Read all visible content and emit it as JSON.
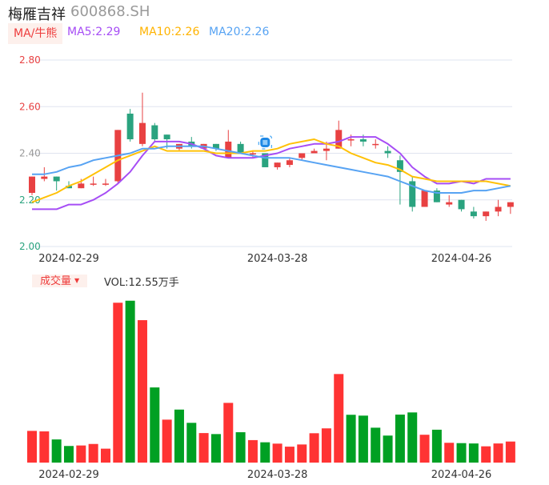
{
  "header": {
    "name": "梅雁吉祥",
    "code": "600868.SH"
  },
  "ma_legend": {
    "tag": "MA/牛熊",
    "ma5": "MA5:2.29",
    "ma10": "MA10:2.26",
    "ma20": "MA20:2.26"
  },
  "volume_legend": {
    "tag": "成交量",
    "value": "VOL:12.55万手"
  },
  "colors": {
    "up": "#e84142",
    "down": "#2aa37f",
    "vol_up": "#ff3333",
    "vol_down": "#00a023",
    "ma5": "#a64df5",
    "ma10": "#ffc107",
    "ma20": "#57a3f3",
    "grid": "#dfe4f0"
  },
  "chart_data": [
    {
      "type": "candlestick",
      "title": "梅雁吉祥 600868.SH",
      "ylim": [
        2.0,
        2.8
      ],
      "y_ticks": [
        "2.80",
        "2.60",
        "2.40",
        "2.20",
        "2.00"
      ],
      "y_tick_values": [
        2.8,
        2.6,
        2.4,
        2.2,
        2.0
      ],
      "y_tick_colors": [
        "#e84142",
        "#e84142",
        "#999999",
        "#2aa37f",
        "#2aa37f"
      ],
      "x_tick_labels": [
        {
          "index": 3,
          "label": "2024-02-29"
        },
        {
          "index": 20,
          "label": "2024-03-28"
        },
        {
          "index": 35,
          "label": "2024-04-26"
        }
      ],
      "ohlc": [
        [
          2.23,
          2.3,
          2.22,
          2.3
        ],
        [
          2.29,
          2.34,
          2.28,
          2.3
        ],
        [
          2.3,
          2.3,
          2.24,
          2.28
        ],
        [
          2.26,
          2.28,
          2.25,
          2.25
        ],
        [
          2.25,
          2.29,
          2.25,
          2.27
        ],
        [
          2.27,
          2.3,
          2.26,
          2.27
        ],
        [
          2.27,
          2.29,
          2.26,
          2.27
        ],
        [
          2.28,
          2.5,
          2.27,
          2.5
        ],
        [
          2.57,
          2.59,
          2.45,
          2.46
        ],
        [
          2.44,
          2.66,
          2.43,
          2.53
        ],
        [
          2.52,
          2.53,
          2.45,
          2.46
        ],
        [
          2.48,
          2.48,
          2.42,
          2.46
        ],
        [
          2.42,
          2.44,
          2.41,
          2.44
        ],
        [
          2.45,
          2.47,
          2.42,
          2.43
        ],
        [
          2.42,
          2.44,
          2.42,
          2.44
        ],
        [
          2.44,
          2.44,
          2.41,
          2.42
        ],
        [
          2.38,
          2.5,
          2.38,
          2.45
        ],
        [
          2.44,
          2.45,
          2.4,
          2.4
        ],
        [
          2.4,
          2.41,
          2.38,
          2.4
        ],
        [
          2.4,
          2.4,
          2.34,
          2.34
        ],
        [
          2.34,
          2.36,
          2.33,
          2.36
        ],
        [
          2.35,
          2.38,
          2.34,
          2.37
        ],
        [
          2.38,
          2.4,
          2.37,
          2.4
        ],
        [
          2.4,
          2.42,
          2.4,
          2.41
        ],
        [
          2.41,
          2.45,
          2.37,
          2.42
        ],
        [
          2.42,
          2.54,
          2.42,
          2.5
        ],
        [
          2.46,
          2.48,
          2.43,
          2.46
        ],
        [
          2.46,
          2.48,
          2.43,
          2.45
        ],
        [
          2.44,
          2.46,
          2.42,
          2.44
        ],
        [
          2.41,
          2.43,
          2.38,
          2.4
        ],
        [
          2.37,
          2.39,
          2.18,
          2.32
        ],
        [
          2.28,
          2.3,
          2.15,
          2.17
        ],
        [
          2.17,
          2.24,
          2.17,
          2.24
        ],
        [
          2.24,
          2.25,
          2.19,
          2.19
        ],
        [
          2.18,
          2.22,
          2.17,
          2.19
        ],
        [
          2.2,
          2.2,
          2.15,
          2.16
        ],
        [
          2.15,
          2.17,
          2.12,
          2.13
        ],
        [
          2.13,
          2.15,
          2.11,
          2.15
        ],
        [
          2.15,
          2.2,
          2.13,
          2.17
        ],
        [
          2.17,
          2.19,
          2.14,
          2.19
        ]
      ],
      "series": [
        {
          "name": "MA5",
          "values": [
            2.16,
            2.16,
            2.16,
            2.18,
            2.18,
            2.2,
            2.23,
            2.27,
            2.32,
            2.39,
            2.45,
            2.45,
            2.45,
            2.44,
            2.42,
            2.39,
            2.38,
            2.38,
            2.38,
            2.39,
            2.4,
            2.42,
            2.43,
            2.44,
            2.44,
            2.45,
            2.47,
            2.47,
            2.47,
            2.44,
            2.4,
            2.34,
            2.3,
            2.27,
            2.27,
            2.28,
            2.27,
            2.29,
            2.29,
            2.29
          ]
        },
        {
          "name": "MA10",
          "values": [
            2.19,
            2.21,
            2.23,
            2.26,
            2.28,
            2.31,
            2.34,
            2.37,
            2.39,
            2.41,
            2.43,
            2.41,
            2.41,
            2.41,
            2.41,
            2.4,
            2.4,
            2.4,
            2.41,
            2.41,
            2.42,
            2.44,
            2.45,
            2.46,
            2.44,
            2.43,
            2.4,
            2.38,
            2.36,
            2.35,
            2.33,
            2.3,
            2.29,
            2.28,
            2.28,
            2.28,
            2.28,
            2.28,
            2.27,
            2.26
          ]
        },
        {
          "name": "MA20",
          "values": [
            2.31,
            2.31,
            2.32,
            2.34,
            2.35,
            2.37,
            2.38,
            2.39,
            2.4,
            2.42,
            2.42,
            2.43,
            2.43,
            2.43,
            2.43,
            2.42,
            2.41,
            2.4,
            2.39,
            2.38,
            2.38,
            2.38,
            2.37,
            2.36,
            2.35,
            2.34,
            2.33,
            2.32,
            2.31,
            2.3,
            2.28,
            2.26,
            2.24,
            2.23,
            2.23,
            2.23,
            2.24,
            2.24,
            2.25,
            2.26
          ]
        }
      ],
      "marker": {
        "index": 19,
        "icon": "bull-bear-icon"
      }
    },
    {
      "type": "bar",
      "title": "成交量",
      "unit": "万手",
      "ylim": [
        0,
        100
      ],
      "x_tick_labels": [
        {
          "index": 3,
          "label": "2024-02-29"
        },
        {
          "index": 20,
          "label": "2024-03-28"
        },
        {
          "index": 35,
          "label": "2024-04-26"
        }
      ],
      "values": [
        18.9,
        18.6,
        13.8,
        9.9,
        10.2,
        11.1,
        8.3,
        95.3,
        96.5,
        84.9,
        44.8,
        25.6,
        31.6,
        23.7,
        17.6,
        17.0,
        35.6,
        18.1,
        13.4,
        12.1,
        11.3,
        9.5,
        10.8,
        17.5,
        20.4,
        52.8,
        28.5,
        28.0,
        20.8,
        16.1,
        28.6,
        29.9,
        16.6,
        19.6,
        11.8,
        11.6,
        11.4,
        9.7,
        11.4,
        12.55
      ],
      "directions": [
        "up",
        "up",
        "down",
        "down",
        "up",
        "up",
        "up",
        "up",
        "down",
        "up",
        "down",
        "up",
        "down",
        "down",
        "up",
        "down",
        "up",
        "down",
        "up",
        "down",
        "up",
        "up",
        "up",
        "up",
        "up",
        "up",
        "down",
        "down",
        "down",
        "down",
        "down",
        "down",
        "up",
        "down",
        "up",
        "down",
        "down",
        "up",
        "up",
        "up"
      ]
    }
  ]
}
